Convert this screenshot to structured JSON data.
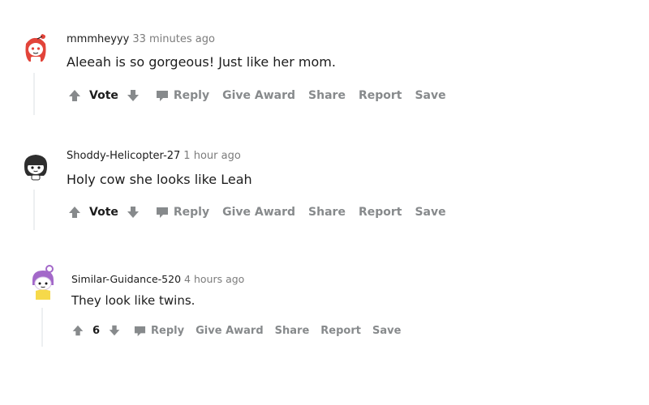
{
  "comments": [
    {
      "author": "mmmheyyy",
      "time": "33 minutes ago",
      "text": "Aleeah is so gorgeous! Just like her mom.",
      "vote_label": "Vote",
      "actions": {
        "reply": "Reply",
        "give_award": "Give Award",
        "share": "Share",
        "report": "Report",
        "save": "Save"
      },
      "avatar_icon": "snoo-avatar-red"
    },
    {
      "author": "Shoddy-Helicopter-27",
      "time": "1 hour ago",
      "text": "Holy cow she looks like Leah",
      "vote_label": "Vote",
      "actions": {
        "reply": "Reply",
        "give_award": "Give Award",
        "share": "Share",
        "report": "Report",
        "save": "Save"
      },
      "avatar_icon": "snoo-avatar-dark"
    },
    {
      "author": "Similar-Guidance-520",
      "time": "4 hours ago",
      "text": "They look like twins.",
      "vote_label": "6",
      "actions": {
        "reply": "Reply",
        "give_award": "Give Award",
        "share": "Share",
        "report": "Report",
        "save": "Save"
      },
      "avatar_icon": "snoo-avatar-purple"
    }
  ],
  "colors": {
    "meta_gray": "#7c7c7c",
    "action_gray": "#878a8c",
    "text": "#1c1c1c",
    "thread_line": "#edeff1"
  }
}
